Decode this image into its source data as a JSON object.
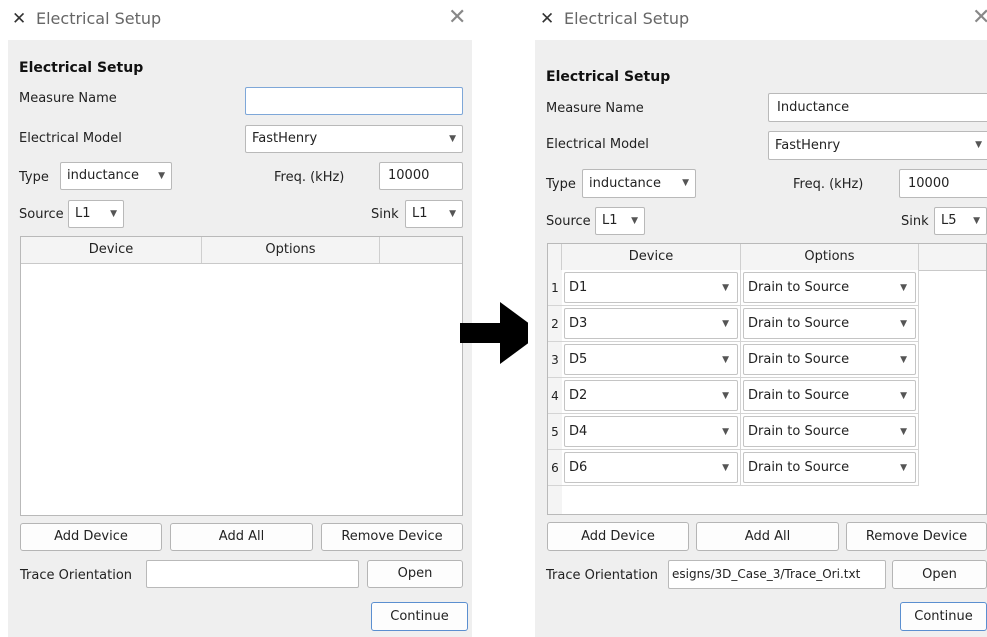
{
  "left_window": {
    "title": "Electrical Setup",
    "heading": "Electrical Setup",
    "measure_name_label": "Measure Name",
    "measure_name_value": "",
    "electrical_model_label": "Electrical Model",
    "electrical_model_value": "FastHenry",
    "type_label": "Type",
    "type_value": "inductance",
    "freq_label": "Freq. (kHz)",
    "freq_value": "10000",
    "source_label": "Source",
    "source_value": "L1",
    "sink_label": "Sink",
    "sink_value": "L1",
    "table_headers": [
      "Device",
      "Options"
    ],
    "add_device": "Add Device",
    "add_all": "Add All",
    "remove_device": "Remove Device",
    "trace_orientation_label": "Trace Orientation",
    "trace_orientation_value": "",
    "open": "Open",
    "continue": "Continue"
  },
  "right_window": {
    "title": "Electrical Setup",
    "heading": "Electrical Setup",
    "measure_name_label": "Measure Name",
    "measure_name_value": "Inductance",
    "electrical_model_label": "Electrical Model",
    "electrical_model_value": "FastHenry",
    "type_label": "Type",
    "type_value": "inductance",
    "freq_label": "Freq. (kHz)",
    "freq_value": "10000",
    "source_label": "Source",
    "source_value": "L1",
    "sink_label": "Sink",
    "sink_value": "L5",
    "table_headers": [
      "Device",
      "Options"
    ],
    "rows": [
      {
        "num": "1",
        "device": "D1",
        "option": "Drain to Source"
      },
      {
        "num": "2",
        "device": "D3",
        "option": "Drain to Source"
      },
      {
        "num": "3",
        "device": "D5",
        "option": "Drain to Source"
      },
      {
        "num": "4",
        "device": "D2",
        "option": "Drain to Source"
      },
      {
        "num": "5",
        "device": "D4",
        "option": "Drain to Source"
      },
      {
        "num": "6",
        "device": "D6",
        "option": "Drain to Source"
      }
    ],
    "add_device": "Add Device",
    "add_all": "Add All",
    "remove_device": "Remove Device",
    "trace_orientation_label": "Trace Orientation",
    "trace_orientation_value": "esigns/3D_Case_3/Trace_Ori.txt",
    "open": "Open",
    "continue": "Continue"
  },
  "icons": {
    "logo": "app-logo-icon",
    "close": "close-icon",
    "dropdown": "chevron-down-icon",
    "arrow": "right-arrow-icon"
  }
}
